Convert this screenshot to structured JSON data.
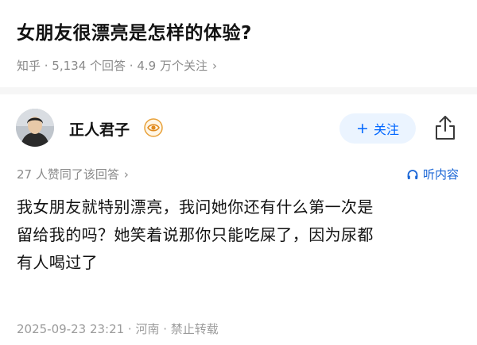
{
  "question": {
    "title": "女朋友很漂亮是怎样的体验?",
    "meta": "知乎 · 5,134 个回答 · 4.9 万个关注"
  },
  "author": {
    "name": "正人君子",
    "follow_label": "关注"
  },
  "answer": {
    "votes_text": "27 人赞同了该回答",
    "listen_label": "听内容",
    "lines": [
      "我女朋友就特别漂亮，我问她你还有什么第一次是",
      "留给我的吗？她笑着说那你只能吃屎了，因为尿都",
      "有人喝过了"
    ],
    "footer": "2025-09-23 23:21 · 河南 · 禁止转载"
  },
  "colors": {
    "accent": "#0066ff",
    "follow_bg": "#ebf4ff",
    "muted": "#8a8a8a"
  },
  "icons": {
    "share": "share-icon",
    "headphone": "headphone-icon",
    "badge": "eye-badge-icon",
    "chevron": "chevron-right-icon"
  }
}
